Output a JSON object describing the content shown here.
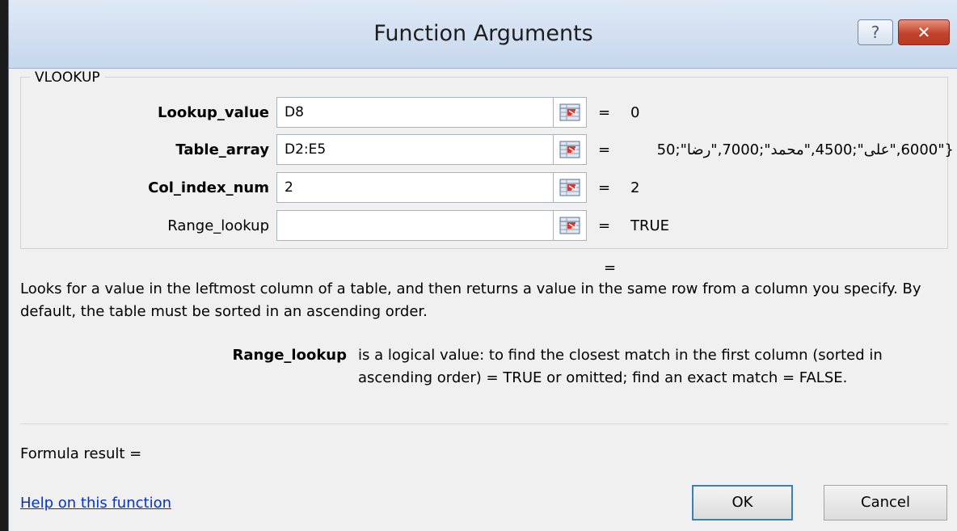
{
  "window": {
    "title": "Function Arguments",
    "help_glyph": "?",
    "close_glyph": "✕"
  },
  "group": {
    "label": "VLOOKUP"
  },
  "arguments": [
    {
      "label": "Lookup_value",
      "value": "D8",
      "result": "0"
    },
    {
      "label": "Table_array",
      "value": "D2:E5",
      "result": "{\"6000,\"على\";4500,\"محمد\";7000,\"رضا\";50"
    },
    {
      "label": "Col_index_num",
      "value": "2",
      "result": "2"
    },
    {
      "label": "Range_lookup",
      "value": "",
      "result": "TRUE"
    }
  ],
  "equals": "=",
  "description": "Looks for a value in the leftmost column of a table, and then returns a value in the same row from a column you specify. By default, the table must be sorted in an ascending order.",
  "param_help": {
    "name": "Range_lookup",
    "text": "is a logical value: to find the closest match in the first column (sorted in ascending order) = TRUE or omitted; find an exact match = FALSE."
  },
  "formula_result_label": "Formula result =",
  "help_link": "Help on this function",
  "buttons": {
    "ok": "OK",
    "cancel": "Cancel"
  },
  "icons": {
    "range-selector-icon": "collapse dialog / select range",
    "help-icon": "question mark",
    "close-icon": "x"
  }
}
